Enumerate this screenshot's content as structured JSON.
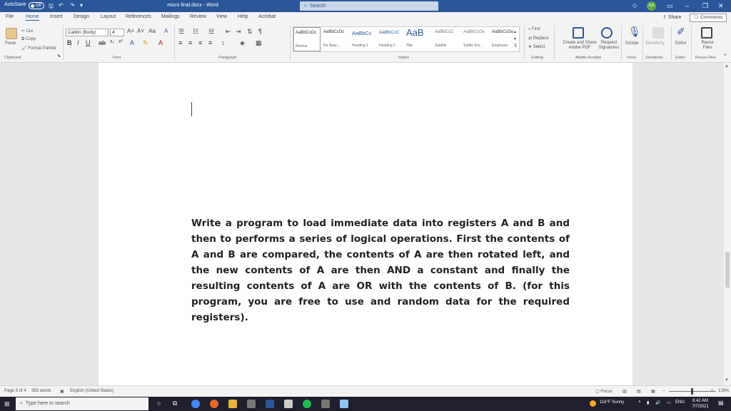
{
  "titlebar": {
    "autosave": "AutoSave",
    "autosave_state": "Off",
    "doc_title": "micro final.docx - Word",
    "search_placeholder": "Search",
    "avatar_initials": "AA"
  },
  "tabs": [
    "File",
    "Home",
    "Insert",
    "Design",
    "Layout",
    "References",
    "Mailings",
    "Review",
    "View",
    "Help",
    "Acrobat"
  ],
  "share_label": "Share",
  "comments_label": "Comments",
  "ribbon": {
    "clipboard": {
      "paste": "Paste",
      "cut": "Cut",
      "copy": "Copy",
      "format_painter": "Format Painter",
      "label": "Clipboard"
    },
    "font": {
      "name": "Calibri (Body)",
      "size": "4",
      "label": "Font"
    },
    "paragraph_label": "Paragraph",
    "styles_label": "Styles",
    "styles": [
      {
        "sample": "AaBbCcDc",
        "name": "Normal"
      },
      {
        "sample": "AaBbCcDc",
        "name": "No Spac..."
      },
      {
        "sample": "AaBbCc",
        "name": "Heading 1"
      },
      {
        "sample": "AaBbCcC",
        "name": "Heading 2"
      },
      {
        "sample": "AaB",
        "name": "Title"
      },
      {
        "sample": "AaBbCcD",
        "name": "Subtitle"
      },
      {
        "sample": "AaBbCcDa",
        "name": "Subtle Em..."
      },
      {
        "sample": "AaBbCcDa",
        "name": "Emphasis"
      }
    ],
    "editing": {
      "find": "Find",
      "replace": "Replace",
      "select": "Select",
      "label": "Editing"
    },
    "acrobat": {
      "create_share": "Create and Share Adobe PDF",
      "request": "Request Signatures",
      "label": "Adobe Acrobat"
    },
    "voice": {
      "dictate": "Dictate",
      "label": "Voice"
    },
    "sensitivity": {
      "button": "Sensitivity",
      "label": "Sensitivity"
    },
    "editor": {
      "button": "Editor",
      "label": "Editor"
    },
    "reuse": {
      "button": "Reuse Files",
      "label": "Reuse Files"
    }
  },
  "document": {
    "body": "Write a program to load immediate data into registers A and B and then to performs a series of logical operations. First the contents of A and B are compared, the contents of A are then rotated left, and the new contents of A are then AND a constant and finally the resulting contents of A are OR with the contents of B. (for this program, you are free to use and random data for the required registers)."
  },
  "statusbar": {
    "page": "Page 3 of 4",
    "words": "383 words",
    "language": "English (United States)",
    "focus": "Focus",
    "zoom": "126%"
  },
  "taskbar": {
    "search_placeholder": "Type here to search",
    "weather": "116°F Sunny",
    "lang": "ENG",
    "time": "6:42 AM",
    "date": "7/7/2021"
  },
  "colors": {
    "word_blue": "#2b579a",
    "taskbar": "#1f1f2e"
  }
}
